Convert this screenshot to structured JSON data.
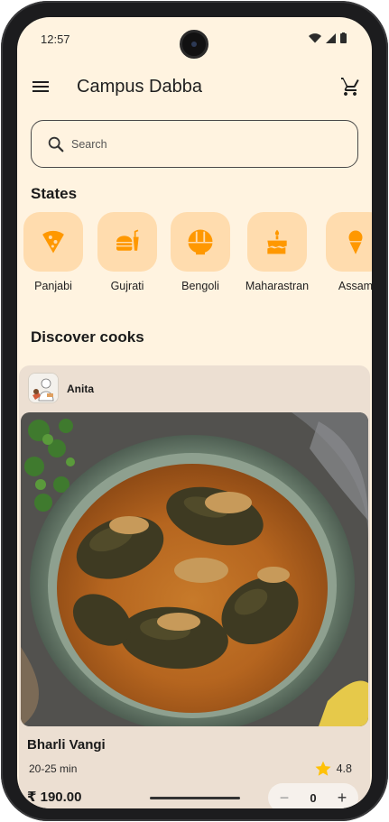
{
  "status_bar": {
    "time": "12:57"
  },
  "app_bar": {
    "title": "Campus Dabba"
  },
  "search": {
    "placeholder": "Search"
  },
  "states_section": {
    "title": "States",
    "items": [
      {
        "label": "Panjabi",
        "icon": "pizza-icon"
      },
      {
        "label": "Gujrati",
        "icon": "fastfood-icon"
      },
      {
        "label": "Bengoli",
        "icon": "ramen-dining-icon"
      },
      {
        "label": "Maharastran",
        "icon": "cake-icon"
      },
      {
        "label": "Assam",
        "icon": "icecream-icon"
      }
    ]
  },
  "cooks_section": {
    "title": "Discover cooks",
    "card": {
      "cook_name": "Anita",
      "dish_name": "Bharli Vangi",
      "time": "20-25 min",
      "rating": "4.8",
      "price": "₹ 190.00",
      "quantity": "0"
    }
  },
  "colors": {
    "background": "#fff3e0",
    "accent": "#ff9800",
    "chip_bg": "#ffdcae",
    "card_bg": "#ecdfd2",
    "star": "#ffc107"
  }
}
